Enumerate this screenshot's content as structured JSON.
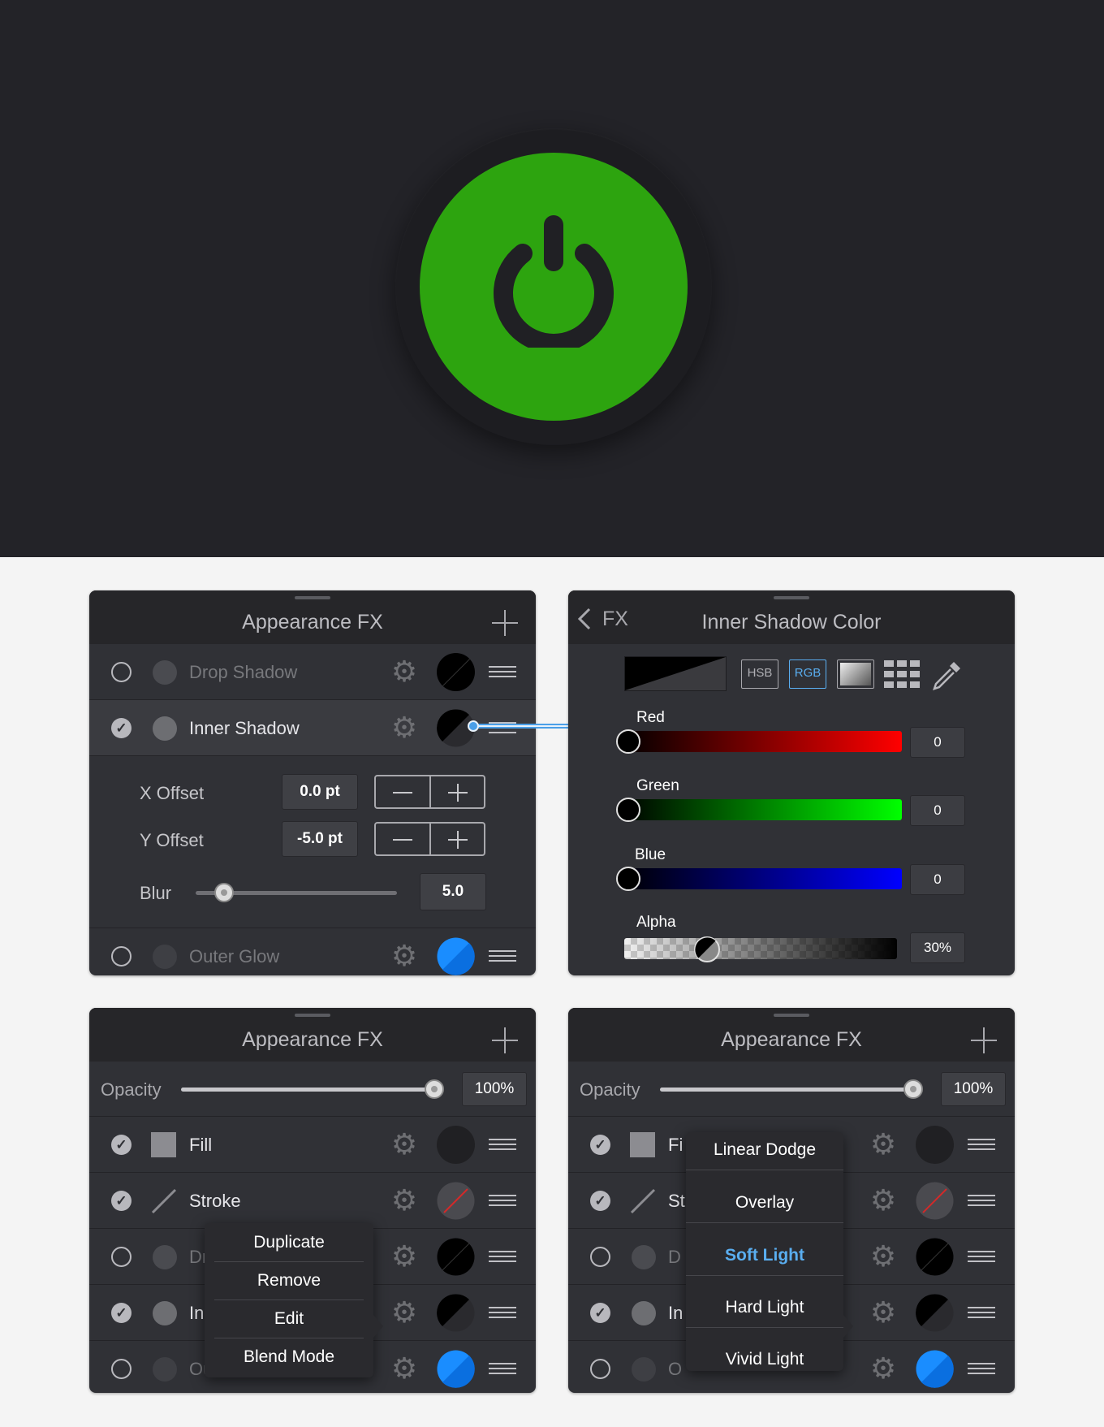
{
  "stage": {
    "button_color": "#2da40f",
    "icon": "power-icon"
  },
  "panel_fx_edit": {
    "title": "Appearance FX",
    "rows": [
      {
        "label": "Drop Shadow",
        "enabled": false
      },
      {
        "label": "Inner Shadow",
        "enabled": true
      },
      {
        "label": "Outer Glow",
        "enabled": false
      }
    ],
    "x_offset_label": "X Offset",
    "x_offset_value": "0.0 pt",
    "y_offset_label": "Y Offset",
    "y_offset_value": "-5.0 pt",
    "blur_label": "Blur",
    "blur_value": "5.0"
  },
  "panel_color": {
    "back_label": "FX",
    "title": "Inner Shadow Color",
    "modes": [
      "HSB",
      "RGB"
    ],
    "active_mode": "RGB",
    "channels": [
      {
        "label": "Red",
        "value": "0"
      },
      {
        "label": "Green",
        "value": "0"
      },
      {
        "label": "Blue",
        "value": "0"
      },
      {
        "label": "Alpha",
        "value": "30%"
      }
    ]
  },
  "panel_context": {
    "title": "Appearance FX",
    "opacity_label": "Opacity",
    "opacity_value": "100%",
    "rows": [
      {
        "label": "Fill",
        "enabled": true
      },
      {
        "label": "Stroke",
        "enabled": true
      },
      {
        "label": "Dr",
        "enabled": false
      },
      {
        "label": "In",
        "enabled": true
      },
      {
        "label": "Ou",
        "enabled": false
      }
    ],
    "menu": [
      "Duplicate",
      "Remove",
      "Edit",
      "Blend Mode"
    ]
  },
  "panel_blend": {
    "title": "Appearance FX",
    "opacity_label": "Opacity",
    "opacity_value": "100%",
    "rows": [
      {
        "label": "Fi",
        "enabled": true
      },
      {
        "label": "St",
        "enabled": true
      },
      {
        "label": "D",
        "enabled": false
      },
      {
        "label": "In",
        "enabled": true
      },
      {
        "label": "O",
        "enabled": false
      }
    ],
    "blend_modes": [
      "Linear Dodge",
      "Overlay",
      "Soft Light",
      "Hard Light",
      "Vivid Light"
    ],
    "selected_mode": "Soft Light",
    "selected_color": "#5aaef0"
  }
}
